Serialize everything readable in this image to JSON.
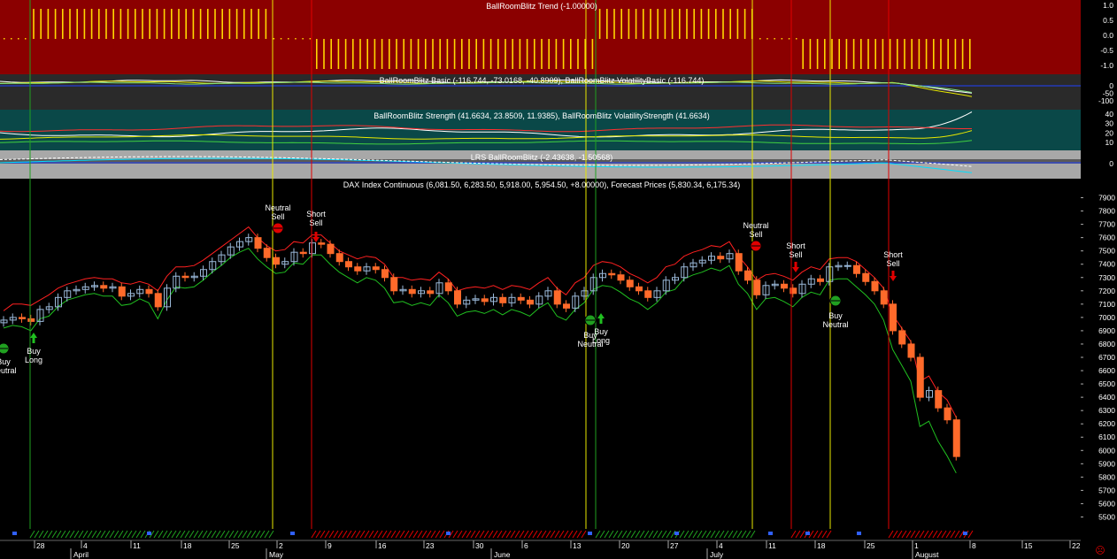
{
  "panels": {
    "trend_title": "BallRoomBlitz Trend (-1.00000)",
    "basic_title": "BallRoomBlitz Basic (-116.744, -73.0168, -40.8909), BallRoomBlitz VolatilityBasic (-116.744)",
    "strength_title": "BallRoomBlitz Strength (41.6634, 23.8509, 11.9385), BallRoomBlitz VolatilityStrength (41.6634)",
    "lrs_title": "LRS BallRoomBlitz (-2.43638, -1.50568)",
    "price_title": "DAX Index Continuous (6,081.50, 6,283.50, 5,918.00, 5,954.50, +8.00000), Forecast Prices (5,830.34, 6,175.34)"
  },
  "axes": {
    "trend_ticks": [
      "1.0",
      "0.5",
      "0.0",
      "-0.5",
      "-1.0"
    ],
    "basic_ticks": [
      "0",
      "-50",
      "-100"
    ],
    "strength_ticks": [
      "40",
      "30",
      "20",
      "10"
    ],
    "lrs_ticks": [
      "0"
    ],
    "price_ticks": [
      "7900",
      "7800",
      "7700",
      "7600",
      "7500",
      "7400",
      "7300",
      "7200",
      "7100",
      "7000",
      "6900",
      "6800",
      "6700",
      "6600",
      "6500",
      "6400",
      "6300",
      "6200",
      "6100",
      "6000",
      "5900",
      "5800",
      "5700",
      "5600",
      "5500"
    ],
    "date_ticks": [
      "28",
      "4",
      "11",
      "18",
      "25",
      "2",
      "9",
      "16",
      "23",
      "30",
      "6",
      "13",
      "20",
      "27",
      "4",
      "11",
      "18",
      "25",
      "1",
      "8",
      "15",
      "22"
    ],
    "month_labels": [
      "April",
      "May",
      "June",
      "July",
      "August"
    ]
  },
  "signals": [
    {
      "line1": "Buy",
      "line2": "Neutral"
    },
    {
      "line1": "Buy",
      "line2": "Long"
    },
    {
      "line1": "Neutral",
      "line2": "Sell"
    },
    {
      "line1": "Short",
      "line2": "Sell"
    },
    {
      "line1": "Buy",
      "line2": "Neutral"
    },
    {
      "line1": "Buy",
      "line2": "Long"
    },
    {
      "line1": "Neutral",
      "line2": "Sell"
    },
    {
      "line1": "Short",
      "line2": "Sell"
    },
    {
      "line1": "Buy",
      "line2": "Neutral"
    },
    {
      "line1": "Short",
      "line2": "Sell"
    }
  ],
  "colors": {
    "trend_bg": "#8b0000",
    "basic_bg": "#2a2a2a",
    "strength_bg": "#0a4848",
    "lrs_bg": "#a8a8a8",
    "up_candle": "#9ab8d8",
    "down_candle": "#ff6a2a",
    "upper_band": "#ff2020",
    "lower_band": "#20c020",
    "buy_line": "#20a020",
    "neutral_line": "#e8e800",
    "sell_line": "#e00000"
  },
  "chart_data": {
    "type": "candlestick",
    "title": "DAX Index Continuous (6,081.50, 6,283.50, 5,918.00, 5,954.50, +8.00000), Forecast Prices (5,830.34, 6,175.34)",
    "ylim": [
      5450,
      7950
    ],
    "last_bar": {
      "open": 6081.5,
      "high": 6283.5,
      "low": 5918.0,
      "close": 5954.5,
      "change": 8.0
    },
    "forecast_prices": [
      5830.34,
      6175.34
    ],
    "close": [
      6980,
      7000,
      6990,
      6970,
      7060,
      7080,
      7150,
      7200,
      7210,
      7230,
      7240,
      7220,
      7230,
      7160,
      7180,
      7210,
      7180,
      7080,
      7220,
      7310,
      7300,
      7310,
      7360,
      7420,
      7470,
      7530,
      7570,
      7600,
      7520,
      7450,
      7400,
      7420,
      7490,
      7480,
      7560,
      7550,
      7480,
      7420,
      7380,
      7350,
      7380,
      7360,
      7300,
      7200,
      7210,
      7180,
      7200,
      7180,
      7260,
      7200,
      7100,
      7130,
      7140,
      7120,
      7150,
      7110,
      7150,
      7130,
      7100,
      7160,
      7200,
      7100,
      7070,
      7160,
      7200,
      7300,
      7330,
      7320,
      7280,
      7230,
      7200,
      7150,
      7200,
      7280,
      7300,
      7380,
      7410,
      7430,
      7460,
      7440,
      7480,
      7350,
      7280,
      7170,
      7240,
      7250,
      7220,
      7180,
      7250,
      7290,
      7270,
      7380,
      7390,
      7390,
      7330,
      7270,
      7200,
      7100,
      6900,
      6800,
      6700,
      6400,
      6450,
      6320,
      6230,
      5954.5
    ],
    "upper_band": [
      7050,
      7100,
      7100,
      7090,
      7130,
      7170,
      7220,
      7250,
      7270,
      7290,
      7300,
      7290,
      7290,
      7260,
      7250,
      7270,
      7250,
      7200,
      7310,
      7380,
      7380,
      7390,
      7430,
      7480,
      7530,
      7580,
      7630,
      7680,
      7600,
      7540,
      7500,
      7510,
      7570,
      7560,
      7620,
      7620,
      7560,
      7500,
      7470,
      7440,
      7460,
      7450,
      7400,
      7300,
      7300,
      7280,
      7290,
      7280,
      7340,
      7290,
      7200,
      7220,
      7230,
      7220,
      7240,
      7210,
      7240,
      7230,
      7210,
      7260,
      7300,
      7220,
      7170,
      7260,
      7300,
      7390,
      7420,
      7410,
      7380,
      7330,
      7300,
      7260,
      7300,
      7380,
      7400,
      7460,
      7490,
      7510,
      7540,
      7530,
      7570,
      7460,
      7380,
      7280,
      7320,
      7330,
      7310,
      7280,
      7340,
      7380,
      7360,
      7440,
      7450,
      7450,
      7420,
      7360,
      7300,
      7220,
      7020,
      6920,
      6820,
      6520,
      6560,
      6440,
      6380,
      6250
    ],
    "lower_band": [
      6920,
      6940,
      6930,
      6900,
      6990,
      7010,
      7080,
      7130,
      7150,
      7170,
      7180,
      7160,
      7160,
      7090,
      7100,
      7140,
      7110,
      6990,
      7130,
      7230,
      7220,
      7230,
      7280,
      7340,
      7390,
      7450,
      7490,
      7520,
      7440,
      7380,
      7330,
      7340,
      7410,
      7400,
      7470,
      7470,
      7400,
      7340,
      7300,
      7260,
      7300,
      7280,
      7220,
      7110,
      7120,
      7090,
      7110,
      7090,
      7170,
      7110,
      7010,
      7040,
      7050,
      7030,
      7060,
      7020,
      7060,
      7040,
      7010,
      7070,
      7110,
      7010,
      6980,
      7060,
      7110,
      7210,
      7240,
      7230,
      7190,
      7140,
      7110,
      7060,
      7110,
      7190,
      7210,
      7290,
      7320,
      7340,
      7370,
      7350,
      7390,
      7250,
      7180,
      7060,
      7140,
      7150,
      7120,
      7080,
      7150,
      7190,
      7170,
      7280,
      7290,
      7290,
      7230,
      7170,
      7100,
      6980,
      6760,
      6640,
      6520,
      6180,
      6220,
      6070,
      5960,
      5830
    ]
  }
}
